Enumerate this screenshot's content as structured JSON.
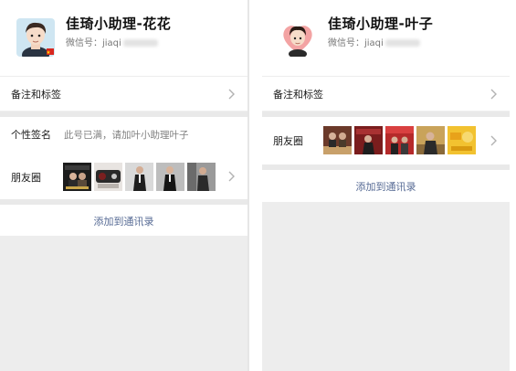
{
  "left_panel": {
    "profile": {
      "name": "佳琦小助理-花花",
      "wechat_id_label": "微信号：jiaqi",
      "avatar_icon": "cartoon-man-avatar"
    },
    "rows": {
      "remarks_label": "备注和标签",
      "signature_label": "个性签名",
      "signature_value": "此号已满，请加叶小助理叶子",
      "moments_label": "朋友圈"
    },
    "add_contact_label": "添加到通讯录"
  },
  "right_panel": {
    "profile": {
      "name": "佳琦小助理-叶子",
      "wechat_id_label": "微信号：jiaqi",
      "avatar_icon": "cartoon-man-heart-avatar"
    },
    "rows": {
      "remarks_label": "备注和标签",
      "moments_label": "朋友圈"
    },
    "add_contact_label": "添加到通讯录"
  },
  "colors": {
    "link_blue": "#576b95",
    "background_gray": "#ededed",
    "text_dark": "#191919",
    "text_gray": "#808080"
  }
}
